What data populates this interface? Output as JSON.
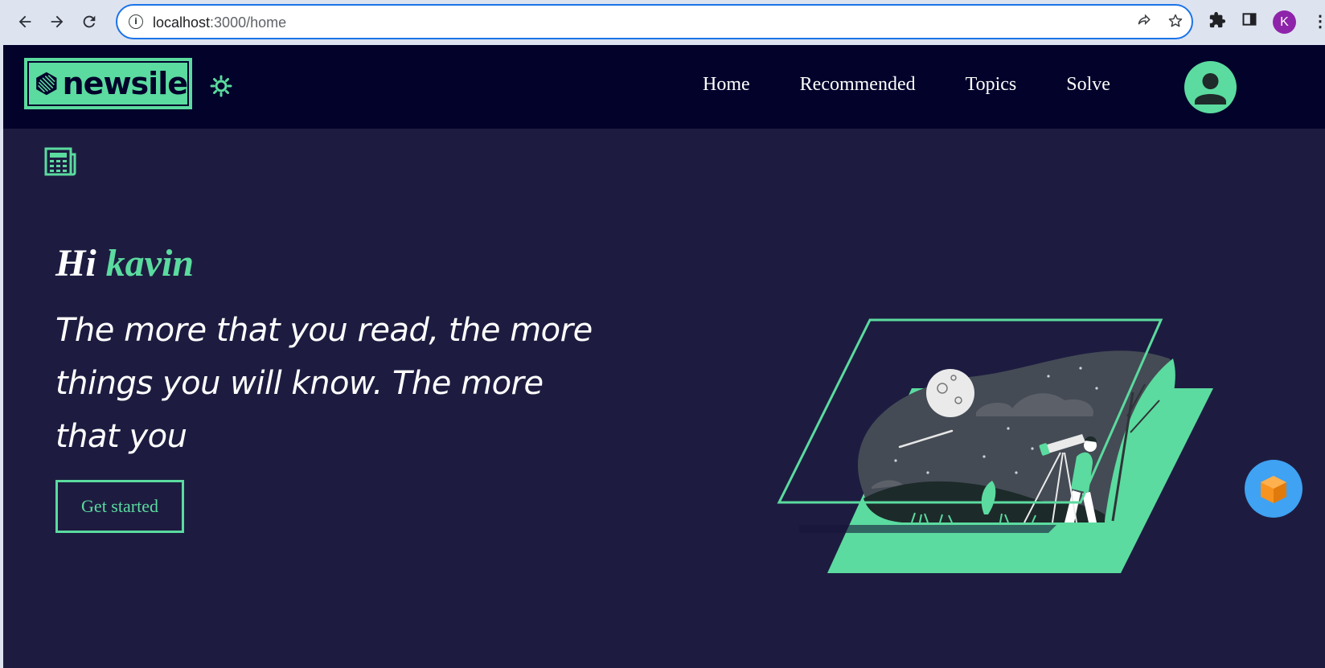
{
  "browser": {
    "url_host": "localhost",
    "url_path": ":3000/home",
    "profile_initial": "K",
    "icons": {
      "back": "back-arrow-icon",
      "forward": "forward-arrow-icon",
      "reload": "reload-icon",
      "site_info": "info-icon",
      "share": "share-icon",
      "bookmark": "star-icon",
      "extensions": "puzzle-icon",
      "side_panel": "side-panel-icon",
      "menu": "kebab-menu-icon"
    }
  },
  "header": {
    "logo_text": "newsile",
    "theme_toggle_icon": "sun-icon",
    "nav": [
      {
        "label": "Home"
      },
      {
        "label": "Recommended"
      },
      {
        "label": "Topics"
      },
      {
        "label": "Solve"
      }
    ],
    "avatar_icon": "user-icon"
  },
  "main": {
    "news_icon": "newspaper-icon",
    "greeting": "Hi",
    "user_name": "kavin",
    "quote": "The more that you read, the more things you will know. The more that you",
    "cta_label": "Get started",
    "illustration": "stargazer-telescope-illustration",
    "chat_widget_icon": "cube-icon"
  },
  "colors": {
    "accent": "#5bdb9f",
    "header_bg": "#02022b",
    "page_bg": "#1d1c40",
    "chrome_bg": "#dee3f0",
    "chat_bg": "#3fa2f2",
    "chat_cube": "#f7931e"
  }
}
